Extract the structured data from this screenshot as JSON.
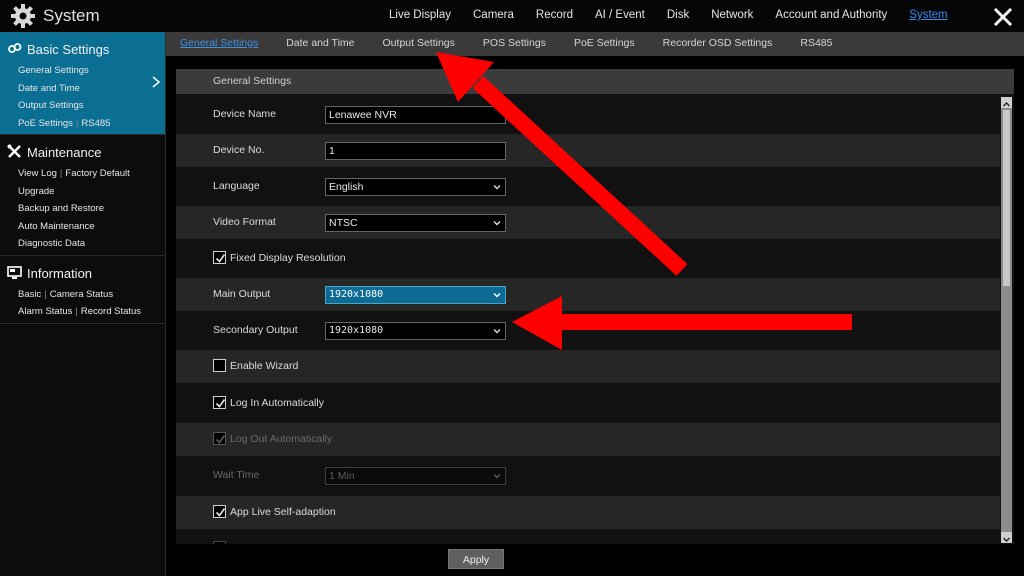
{
  "app": {
    "title": "System",
    "icon": "gear-icon"
  },
  "top_nav": [
    {
      "label": "Live Display",
      "active": false
    },
    {
      "label": "Camera",
      "active": false
    },
    {
      "label": "Record",
      "active": false
    },
    {
      "label": "AI / Event",
      "active": false
    },
    {
      "label": "Disk",
      "active": false
    },
    {
      "label": "Network",
      "active": false
    },
    {
      "label": "Account and Authority",
      "active": false
    },
    {
      "label": "System",
      "active": true
    }
  ],
  "close_icon": "close-icon",
  "sidebar": {
    "basic": {
      "title": "Basic Settings",
      "icon": "link-icon",
      "links": [
        "General Settings",
        "Date and Time",
        "Output Settings",
        "PoE Settings",
        "RS485"
      ]
    },
    "maintenance": {
      "title": "Maintenance",
      "icon": "wrench-icon",
      "links": [
        "View Log",
        "Factory Default",
        "Upgrade",
        "Backup and Restore",
        "Auto Maintenance",
        "Diagnostic Data"
      ]
    },
    "information": {
      "title": "Information",
      "icon": "info-icon",
      "links": [
        "Basic",
        "Camera Status",
        "Alarm Status",
        "Record Status"
      ]
    }
  },
  "sub_tabs": [
    {
      "label": "General Settings",
      "active": true
    },
    {
      "label": "Date and Time",
      "active": false
    },
    {
      "label": "Output Settings",
      "active": false
    },
    {
      "label": "POS Settings",
      "active": false
    },
    {
      "label": "PoE Settings",
      "active": false
    },
    {
      "label": "Recorder OSD Settings",
      "active": false
    },
    {
      "label": "RS485",
      "active": false
    }
  ],
  "panel": {
    "header": "General Settings",
    "device_name": {
      "label": "Device Name",
      "value": "Lenawee NVR"
    },
    "device_no": {
      "label": "Device No.",
      "value": "1"
    },
    "language": {
      "label": "Language",
      "value": "English"
    },
    "video_format": {
      "label": "Video Format",
      "value": "NTSC"
    },
    "fixed_display_resolution": {
      "label": "Fixed Display Resolution",
      "checked": true
    },
    "main_output": {
      "label": "Main Output",
      "value": "1920x1080"
    },
    "secondary_output": {
      "label": "Secondary Output",
      "value": "1920x1080"
    },
    "enable_wizard": {
      "label": "Enable Wizard",
      "checked": false
    },
    "log_in_automatically": {
      "label": "Log In Automatically",
      "checked": true
    },
    "log_out_automatically": {
      "label": "Log Out Automatically",
      "checked": true,
      "disabled": true
    },
    "wait_time": {
      "label": "Wait Time",
      "value": "1 Min",
      "disabled": true
    },
    "app_live_self_adaption": {
      "label": "App Live Self-adaption",
      "checked": true
    }
  },
  "apply_label": "Apply",
  "annotation_color": "#ff0000"
}
